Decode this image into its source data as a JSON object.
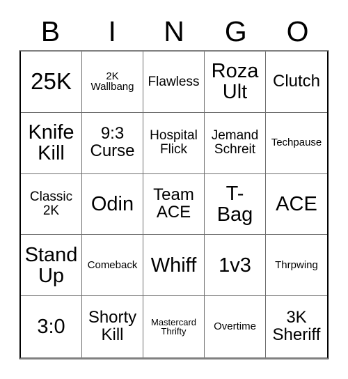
{
  "card": {
    "type": "bingo-card",
    "columns": 5,
    "rows": 5,
    "header": {
      "letters": [
        "B",
        "I",
        "N",
        "G",
        "O"
      ]
    },
    "colors": {
      "background": "#ffffff",
      "text": "#000000",
      "grid_line": "#6e6e6e",
      "border_outer": "#000000",
      "border_shadow": "#808080"
    },
    "cells": [
      {
        "text": "25K",
        "size": "fs-xl",
        "row": 1,
        "col": 1,
        "column_letter": "B"
      },
      {
        "text": "2K\nWallbang",
        "size": "fs-xs",
        "row": 1,
        "col": 2,
        "column_letter": "I"
      },
      {
        "text": "Flawless",
        "size": "fs-sm",
        "row": 1,
        "col": 3,
        "column_letter": "N"
      },
      {
        "text": "Roza\nUlt",
        "size": "fs-lg",
        "row": 1,
        "col": 4,
        "column_letter": "G"
      },
      {
        "text": "Clutch",
        "size": "fs-md",
        "row": 1,
        "col": 5,
        "column_letter": "O"
      },
      {
        "text": "Knife\nKill",
        "size": "fs-lg",
        "row": 2,
        "col": 1,
        "column_letter": "B"
      },
      {
        "text": "9:3\nCurse",
        "size": "fs-md",
        "row": 2,
        "col": 2,
        "column_letter": "I"
      },
      {
        "text": "Hospital\nFlick",
        "size": "fs-sm",
        "row": 2,
        "col": 3,
        "column_letter": "N"
      },
      {
        "text": "Jemand\nSchreit",
        "size": "fs-sm",
        "row": 2,
        "col": 4,
        "column_letter": "G"
      },
      {
        "text": "Techpause",
        "size": "fs-xs",
        "row": 2,
        "col": 5,
        "column_letter": "O"
      },
      {
        "text": "Classic\n2K",
        "size": "fs-sm",
        "row": 3,
        "col": 1,
        "column_letter": "B"
      },
      {
        "text": "Odin",
        "size": "fs-lg",
        "row": 3,
        "col": 2,
        "column_letter": "I"
      },
      {
        "text": "Team\nACE",
        "size": "fs-md",
        "row": 3,
        "col": 3,
        "column_letter": "N"
      },
      {
        "text": "T-\nBag",
        "size": "fs-lg",
        "row": 3,
        "col": 4,
        "column_letter": "G"
      },
      {
        "text": "ACE",
        "size": "fs-lg",
        "row": 3,
        "col": 5,
        "column_letter": "O"
      },
      {
        "text": "Stand\nUp",
        "size": "fs-lg",
        "row": 4,
        "col": 1,
        "column_letter": "B"
      },
      {
        "text": "Comeback",
        "size": "fs-xs",
        "row": 4,
        "col": 2,
        "column_letter": "I"
      },
      {
        "text": "Whiff",
        "size": "fs-lg",
        "row": 4,
        "col": 3,
        "column_letter": "N"
      },
      {
        "text": "1v3",
        "size": "fs-lg",
        "row": 4,
        "col": 4,
        "column_letter": "G"
      },
      {
        "text": "Thrpwing",
        "size": "fs-xs",
        "row": 4,
        "col": 5,
        "column_letter": "O"
      },
      {
        "text": "3:0",
        "size": "fs-lg",
        "row": 5,
        "col": 1,
        "column_letter": "B"
      },
      {
        "text": "Shorty\nKill",
        "size": "fs-md",
        "row": 5,
        "col": 2,
        "column_letter": "I"
      },
      {
        "text": "Mastercard\nThrifty",
        "size": "fs-xxs",
        "row": 5,
        "col": 3,
        "column_letter": "N"
      },
      {
        "text": "Overtime",
        "size": "fs-xs",
        "row": 5,
        "col": 4,
        "column_letter": "O"
      },
      {
        "text": "3K\nSheriff",
        "size": "fs-md",
        "row": 5,
        "col": 5,
        "column_letter": "O"
      }
    ]
  }
}
